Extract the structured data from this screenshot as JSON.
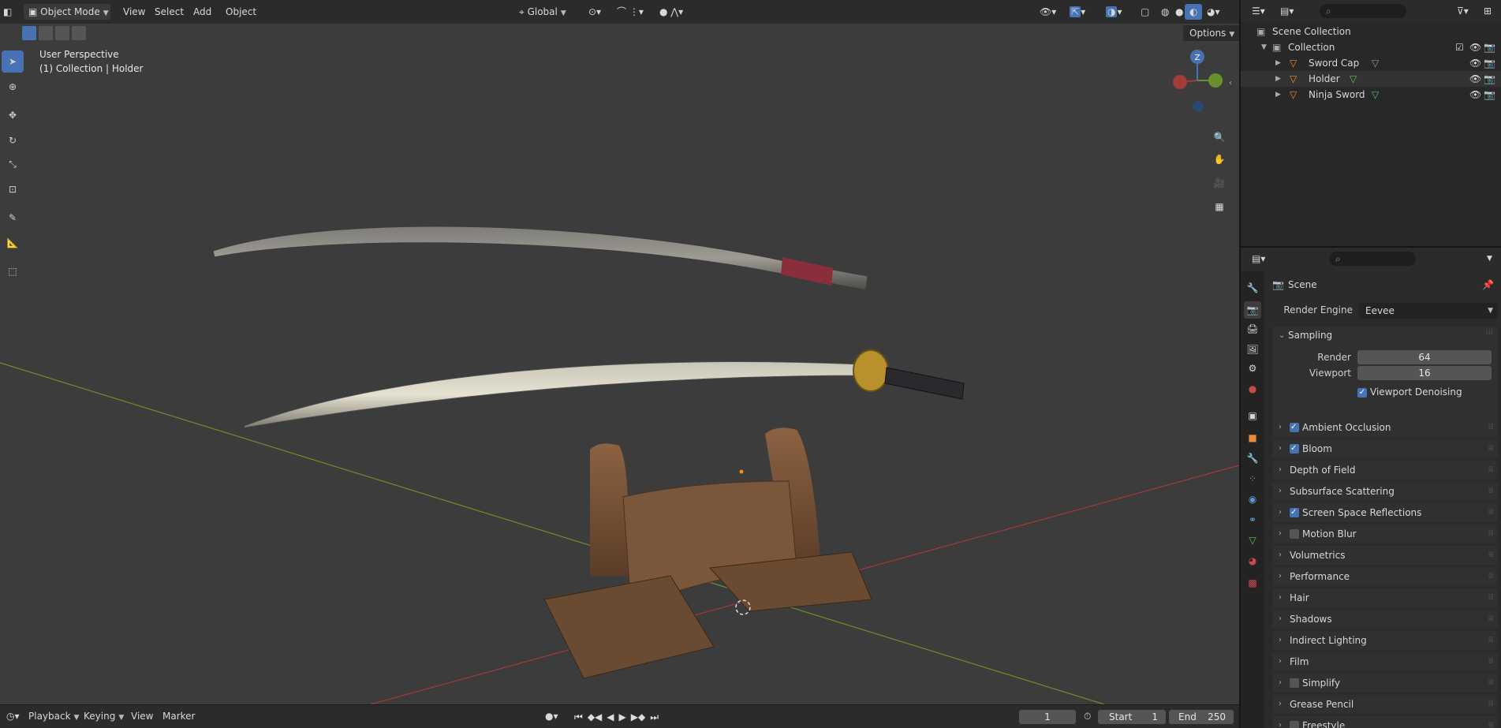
{
  "header": {
    "mode": "Object Mode",
    "menu": [
      "View",
      "Select",
      "Add",
      "Object"
    ],
    "transform_orientation": "Global",
    "options_label": "Options"
  },
  "viewport": {
    "perspective": "User Perspective",
    "collection_info": "(1) Collection | Holder",
    "gizmo_axis_label": "Z",
    "colors": {
      "background": "#3c3c3c",
      "x_axis": "#a33b3b",
      "y_axis": "#6a8f2d",
      "accent": "#4772b3"
    }
  },
  "timeline": {
    "menu": [
      "Playback",
      "Keying",
      "View",
      "Marker"
    ],
    "current_frame": "1",
    "start_label": "Start",
    "start_value": "1",
    "end_label": "End",
    "end_value": "250"
  },
  "outliner": {
    "root": "Scene Collection",
    "collection": "Collection",
    "objects": [
      "Sword Cap",
      "Holder",
      "Ninja Sword"
    ]
  },
  "properties": {
    "scene_label": "Scene",
    "render_engine_label": "Render Engine",
    "render_engine_value": "Eevee",
    "sampling": {
      "title": "Sampling",
      "render_label": "Render",
      "render_value": "64",
      "viewport_label": "Viewport",
      "viewport_value": "16",
      "denoise_label": "Viewport Denoising"
    },
    "panels": [
      {
        "label": "Ambient Occlusion",
        "checkbox": true,
        "checked": true
      },
      {
        "label": "Bloom",
        "checkbox": true,
        "checked": true
      },
      {
        "label": "Depth of Field",
        "checkbox": false,
        "checked": false
      },
      {
        "label": "Subsurface Scattering",
        "checkbox": false,
        "checked": false
      },
      {
        "label": "Screen Space Reflections",
        "checkbox": true,
        "checked": true
      },
      {
        "label": "Motion Blur",
        "checkbox": true,
        "checked": false
      },
      {
        "label": "Volumetrics",
        "checkbox": false,
        "checked": false
      },
      {
        "label": "Performance",
        "checkbox": false,
        "checked": false
      },
      {
        "label": "Hair",
        "checkbox": false,
        "checked": false
      },
      {
        "label": "Shadows",
        "checkbox": false,
        "checked": false
      },
      {
        "label": "Indirect Lighting",
        "checkbox": false,
        "checked": false
      },
      {
        "label": "Film",
        "checkbox": false,
        "checked": false
      },
      {
        "label": "Simplify",
        "checkbox": true,
        "checked": false
      },
      {
        "label": "Grease Pencil",
        "checkbox": false,
        "checked": false
      },
      {
        "label": "Freestyle",
        "checkbox": true,
        "checked": false
      }
    ]
  }
}
